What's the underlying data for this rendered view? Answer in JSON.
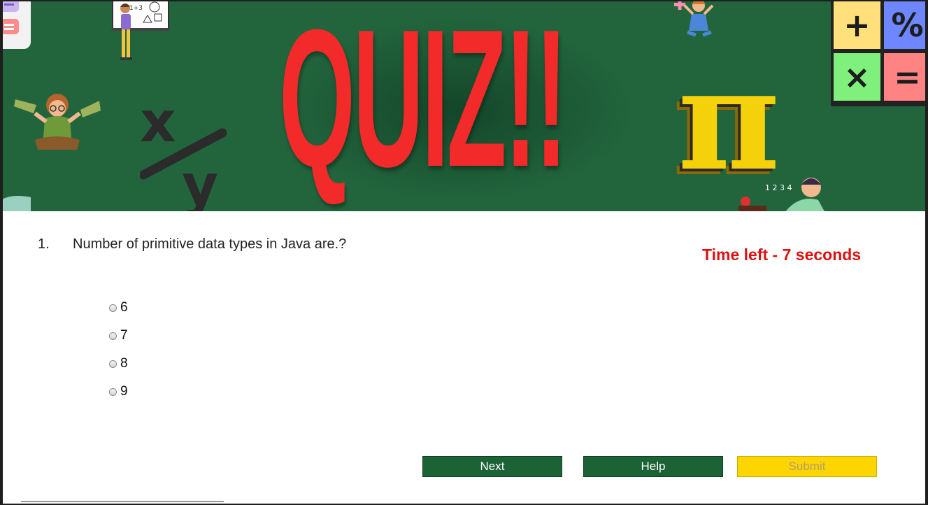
{
  "banner": {
    "title": "QUIZ!!",
    "operators": [
      "+",
      "%",
      "×",
      "="
    ],
    "pi_symbol": "π",
    "fraction_top": "x",
    "fraction_bottom": "y",
    "colors": {
      "background": "#22653d",
      "title": "#f22a2a",
      "pi": "#f5d10c"
    }
  },
  "question": {
    "number": "1.",
    "text": "Number of primitive data types in Java are.?"
  },
  "timer": {
    "text": "Time left - 7 seconds",
    "color": "#e01010"
  },
  "options": [
    {
      "label": "6",
      "selected": false
    },
    {
      "label": "7",
      "selected": false
    },
    {
      "label": "8",
      "selected": false
    },
    {
      "label": "9",
      "selected": false
    }
  ],
  "buttons": {
    "next_label": "Next",
    "help_label": "Help",
    "submit_label": "Submit",
    "submit_enabled": false
  }
}
